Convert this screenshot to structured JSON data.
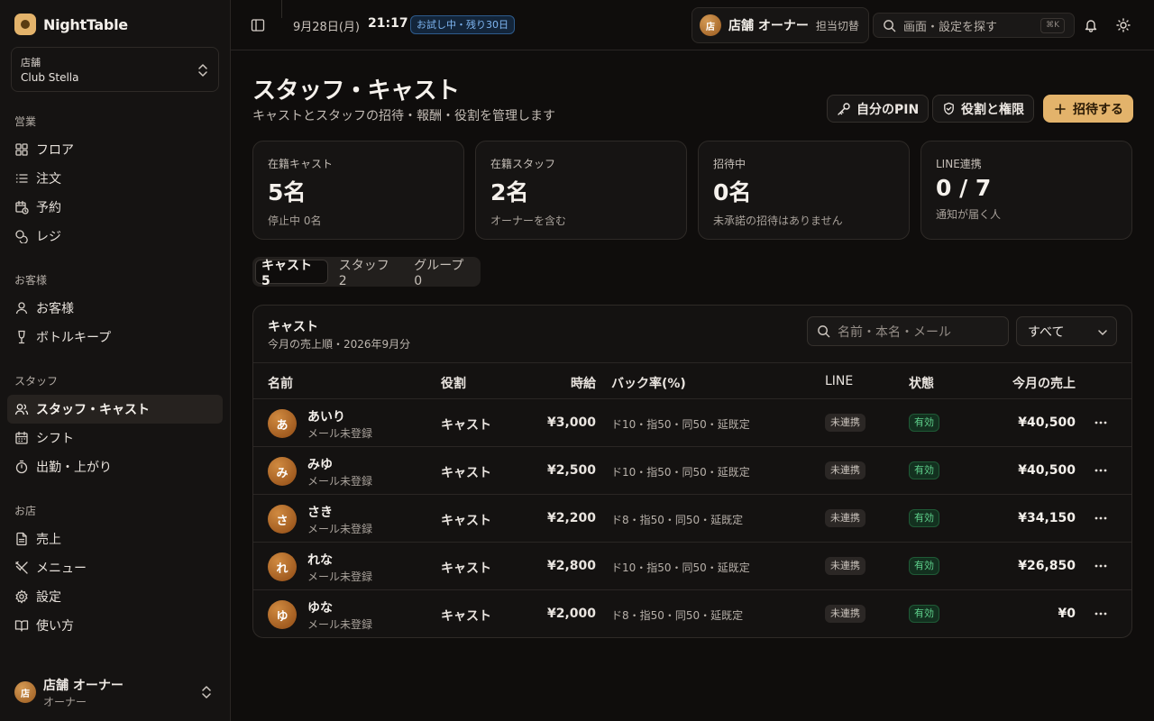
{
  "app": {
    "name": "NightTable"
  },
  "sidebar": {
    "store_label": "店舗",
    "store_name": "Club Stella",
    "sections": [
      {
        "title": "営業",
        "items": [
          {
            "label": "フロア"
          },
          {
            "label": "注文"
          },
          {
            "label": "予約"
          },
          {
            "label": "レジ"
          }
        ]
      },
      {
        "title": "お客様",
        "items": [
          {
            "label": "お客様"
          },
          {
            "label": "ボトルキープ"
          }
        ]
      },
      {
        "title": "スタッフ",
        "items": [
          {
            "label": "スタッフ・キャスト"
          },
          {
            "label": "シフト"
          },
          {
            "label": "出勤・上がり"
          }
        ]
      },
      {
        "title": "お店",
        "items": [
          {
            "label": "売上"
          },
          {
            "label": "メニュー"
          },
          {
            "label": "設定"
          },
          {
            "label": "使い方"
          }
        ]
      }
    ],
    "user": {
      "initial": "店",
      "name": "店舗 オーナー",
      "role": "オーナー"
    }
  },
  "topbar": {
    "date": "9月28日(月)",
    "time": "21:17",
    "trial_badge": "お試し中・残り30日",
    "owner_initial": "店",
    "owner_name": "店舗 オーナー",
    "owner_switch": "担当切替",
    "search_placeholder": "画面・設定を探す",
    "search_shortcut": "⌘K"
  },
  "page": {
    "title": "スタッフ・キャスト",
    "subtitle": "キャストとスタッフの招待・報酬・役割を管理します",
    "buttons": {
      "pin": "自分のPIN",
      "roles": "役割と権限",
      "invite": "招待する"
    }
  },
  "stats": [
    {
      "label": "在籍キャスト",
      "value": "5名",
      "note": "停止中 0名"
    },
    {
      "label": "在籍スタッフ",
      "value": "2名",
      "note": "オーナーを含む"
    },
    {
      "label": "招待中",
      "value": "0名",
      "note": "未承諾の招待はありません"
    },
    {
      "label": "LINE連携",
      "value": "0 / 7",
      "note": "通知が届く人"
    }
  ],
  "tabs": [
    {
      "label": "キャスト 5"
    },
    {
      "label": "スタッフ 2"
    },
    {
      "label": "グループ 0"
    }
  ],
  "table": {
    "title": "キャスト",
    "subtitle": "今月の売上順・2026年9月分",
    "search_placeholder": "名前・本名・メール",
    "filter": "すべて",
    "columns": {
      "name": "名前",
      "role": "役割",
      "wage": "時給",
      "back": "バック率(%)",
      "line": "LINE",
      "status": "状態",
      "sales": "今月の売上"
    },
    "rows": [
      {
        "initial": "あ",
        "name": "あいり",
        "email": "メール未登録",
        "role": "キャスト",
        "wage": "¥3,000",
        "back": "ド10・指50・同50・延既定",
        "line": "未連携",
        "status": "有効",
        "sales": "¥40,500"
      },
      {
        "initial": "み",
        "name": "みゆ",
        "email": "メール未登録",
        "role": "キャスト",
        "wage": "¥2,500",
        "back": "ド10・指50・同50・延既定",
        "line": "未連携",
        "status": "有効",
        "sales": "¥40,500"
      },
      {
        "initial": "さ",
        "name": "さき",
        "email": "メール未登録",
        "role": "キャスト",
        "wage": "¥2,200",
        "back": "ド8・指50・同50・延既定",
        "line": "未連携",
        "status": "有効",
        "sales": "¥34,150"
      },
      {
        "initial": "れ",
        "name": "れな",
        "email": "メール未登録",
        "role": "キャスト",
        "wage": "¥2,800",
        "back": "ド10・指50・同50・延既定",
        "line": "未連携",
        "status": "有効",
        "sales": "¥26,850"
      },
      {
        "initial": "ゆ",
        "name": "ゆな",
        "email": "メール未登録",
        "role": "キャスト",
        "wage": "¥2,000",
        "back": "ド8・指50・同50・延既定",
        "line": "未連携",
        "status": "有効",
        "sales": "¥0"
      }
    ]
  }
}
